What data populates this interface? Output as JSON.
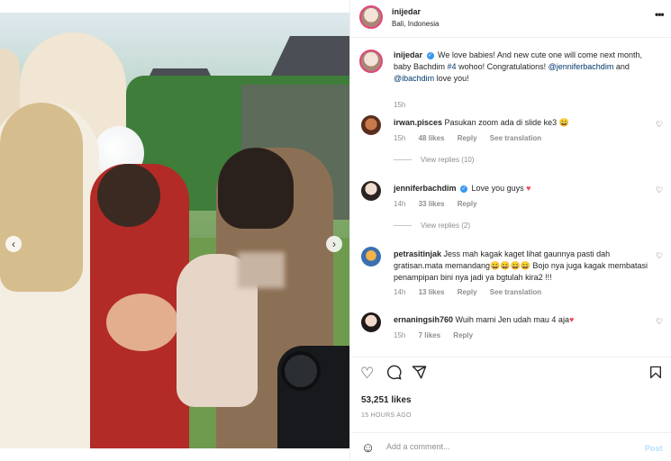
{
  "header": {
    "username": "inijedar",
    "location": "Bali, Indonesia"
  },
  "caption": {
    "username": "inijedar",
    "text_1": "We love babies! And new cute one will come next month, baby Bachdim ",
    "hashtag": "#4",
    "text_2": " wohoo! Congratulations! ",
    "mention_1": "@jenniferbachdim",
    "and": " and ",
    "mention_2": "@ibachdim",
    "text_3": " love you!",
    "time": "15h"
  },
  "comments": [
    {
      "username": "irwan.pisces",
      "text": "Pasukan zoom ada di slide ke3 😄",
      "time": "15h",
      "likes": "48 likes",
      "reply": "Reply",
      "translate": "See translation",
      "view_replies": "View replies (10)"
    },
    {
      "username": "jenniferbachdim",
      "text": "Love you guys ",
      "time": "14h",
      "likes": "33 likes",
      "reply": "Reply",
      "view_replies": "View replies (2)"
    },
    {
      "username": "petrasitinjak",
      "text": "Jess mah kagak kaget lihat gaunnya pasti dah gratisan.mata memandang😄😄😄😄 Bojo nya juga kagak membatasi penampipan bini nya jadi ya bgtulah kira2 !!!",
      "time": "14h",
      "likes": "13 likes",
      "reply": "Reply",
      "translate": "See translation"
    },
    {
      "username": "ernaningsih760",
      "text": "Wuih mami Jen udah mau 4 aja",
      "time": "15h",
      "likes": "7 likes",
      "reply": "Reply"
    }
  ],
  "actions": {
    "likes": "53,251 likes",
    "ago": "15 HOURS AGO"
  },
  "add_comment": {
    "placeholder": "Add a comment...",
    "post": "Post"
  },
  "icons": {
    "like": "heart-icon",
    "comment": "comment-icon",
    "share": "share-icon",
    "save": "bookmark-icon",
    "more": "more-icon",
    "emoji": "emoji-icon"
  }
}
